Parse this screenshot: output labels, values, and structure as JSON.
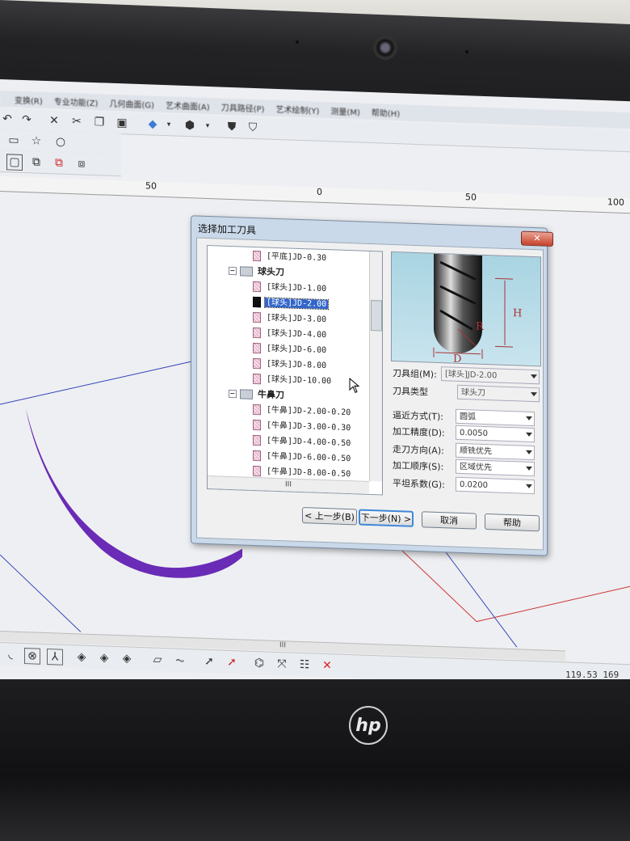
{
  "menubar": [
    "变换(R)",
    "专业功能(Z)",
    "几何曲面(G)",
    "艺术曲面(A)",
    "刀具路径(P)",
    "艺术绘制(Y)",
    "测量(M)",
    "帮助(H)"
  ],
  "ruler": {
    "labels": [
      "50",
      "0",
      "50",
      "100"
    ]
  },
  "status": {
    "coords": "119.53 169"
  },
  "dialog": {
    "title": "选择加工刀具",
    "close_label": "✕",
    "tree": {
      "items": [
        {
          "kind": "tool",
          "label": "[平底]JD-0.30"
        },
        {
          "kind": "group",
          "label": "球头刀"
        },
        {
          "kind": "tool",
          "label": "[球头]JD-1.00"
        },
        {
          "kind": "tool",
          "label": "[球头]JD-2.00",
          "selected": true
        },
        {
          "kind": "tool",
          "label": "[球头]JD-3.00"
        },
        {
          "kind": "tool",
          "label": "[球头]JD-4.00"
        },
        {
          "kind": "tool",
          "label": "[球头]JD-6.00"
        },
        {
          "kind": "tool",
          "label": "[球头]JD-8.00"
        },
        {
          "kind": "tool",
          "label": "[球头]JD-10.00"
        },
        {
          "kind": "group",
          "label": "牛鼻刀"
        },
        {
          "kind": "tool",
          "label": "[牛鼻]JD-2.00-0.20"
        },
        {
          "kind": "tool",
          "label": "[牛鼻]JD-3.00-0.30"
        },
        {
          "kind": "tool",
          "label": "[牛鼻]JD-4.00-0.50"
        },
        {
          "kind": "tool",
          "label": "[牛鼻]JD-6.00-0.50"
        },
        {
          "kind": "tool",
          "label": "[牛鼻]JD-8.00-0.50"
        }
      ],
      "hscroll_label": "III"
    },
    "preview": {
      "labels": {
        "h": "H",
        "r": "R",
        "d": "D"
      }
    },
    "fields": {
      "tool_group": {
        "label": "刀具组(M):",
        "value": "[球头]JD-2.00"
      },
      "tool_type": {
        "label": "刀具类型",
        "value": "球头刀"
      },
      "approach": {
        "label": "逼近方式(T):",
        "value": "圆弧"
      },
      "precision": {
        "label": "加工精度(D):",
        "value": "0.0050"
      },
      "direction": {
        "label": "走刀方向(A):",
        "value": "顺铣优先"
      },
      "order": {
        "label": "加工顺序(S):",
        "value": "区域优先"
      },
      "flatness": {
        "label": "平坦系数(G):",
        "value": "0.0200"
      }
    },
    "buttons": {
      "prev": "< 上一步(B)",
      "next": "下一步(N) >",
      "cancel": "取消",
      "help": "帮助"
    }
  },
  "canvas": {
    "hscroll_label": "III"
  },
  "brand": {
    "logo": "hp"
  }
}
